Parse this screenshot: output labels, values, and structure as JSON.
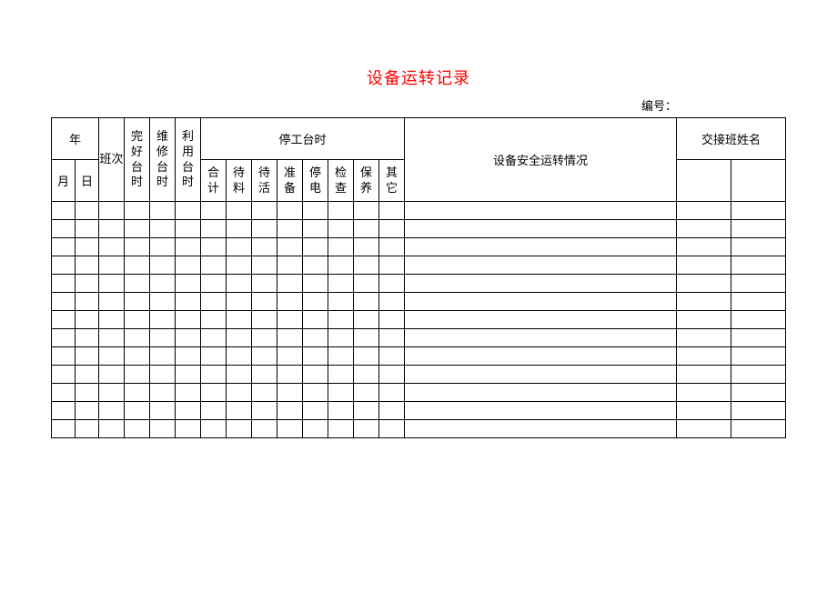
{
  "title": "设备运转记录",
  "serial_label": "编号：",
  "headers": {
    "year": "年",
    "month": "月",
    "day": "日",
    "shift": "班次",
    "intact_hours": "完好台时",
    "repair_hours": "维修台时",
    "utilize_hours": "利用台时",
    "downtime_group": "停工台时",
    "total": "合计",
    "wait_material": "待料",
    "wait_work": "待活",
    "prepare": "准备",
    "power_outage": "停电",
    "inspect": "检查",
    "maintain": "保养",
    "other": "其它",
    "safety_status": "设备安全运转情况",
    "handover_name": "交接班姓名"
  },
  "row_count": 13
}
